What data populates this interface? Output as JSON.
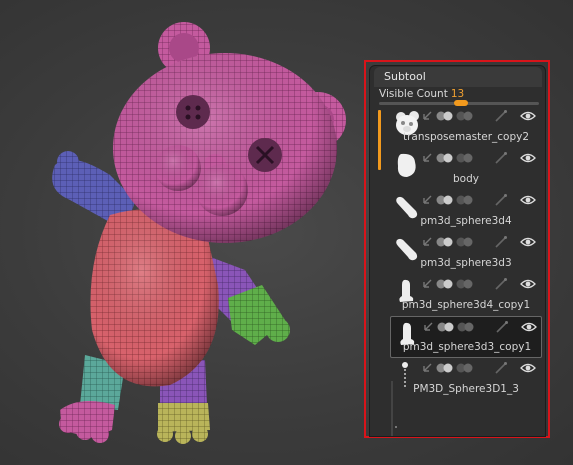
{
  "subtool": {
    "title": "Subtool",
    "visible_count_label": "Visible Count",
    "visible_count_value": "13",
    "visible_count": 13,
    "tools": [
      {
        "name": "transposemaster_copy2",
        "icon": "bear-thumbnail-icon"
      },
      {
        "name": "body",
        "icon": "body-blob-thumbnail-icon"
      },
      {
        "name": "pm3d_sphere3d4",
        "icon": "arm-limb-thumbnail-icon"
      },
      {
        "name": "pm3d_sphere3d3",
        "icon": "arm-limb-thumbnail-icon"
      },
      {
        "name": "pm3d_sphere3d4_copy1",
        "icon": "leg-limb-thumbnail-icon"
      },
      {
        "name": "pm3d_sphere3d3_copy1",
        "icon": "leg-limb-thumbnail-icon",
        "selected": true
      },
      {
        "name": "PM3D_Sphere3D1_3",
        "icon": "sphere-strand-thumbnail-icon"
      }
    ]
  },
  "colors": {
    "highlight_border": "#d8141a",
    "accent": "#f29a1e",
    "panel_bg": "#2e2e2e"
  }
}
